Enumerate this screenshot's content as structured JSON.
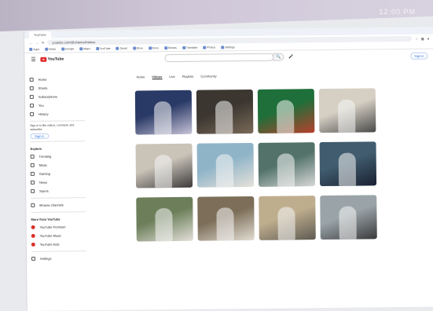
{
  "device": {
    "clock": "12:00 PM"
  },
  "browser": {
    "tab_label": "YouTube",
    "address": "youtube.com/@channel/videos",
    "bookmarks": [
      "Apps",
      "News",
      "Google",
      "Maps",
      "YouTube",
      "Gmail",
      "Drive",
      "Docs",
      "Sheets",
      "Translate",
      "Photos",
      "Settings"
    ]
  },
  "header": {
    "logo_text": "YouTube",
    "search_value": "",
    "signin_label": "Sign in"
  },
  "sidebar": {
    "items": [
      {
        "label": "Home",
        "icon": "home-icon"
      },
      {
        "label": "Shorts",
        "icon": "shorts-icon"
      },
      {
        "label": "Subscriptions",
        "icon": "subscriptions-icon"
      },
      {
        "label": "You",
        "icon": "you-icon"
      },
      {
        "label": "History",
        "icon": "history-icon"
      }
    ],
    "signin_prompt": "Sign in to like videos, comment, and subscribe.",
    "signin_label": "Sign in",
    "explore_title": "Explore",
    "explore": [
      {
        "label": "Trending",
        "icon": "trending-icon"
      },
      {
        "label": "Music",
        "icon": "music-icon"
      },
      {
        "label": "Gaming",
        "icon": "gaming-icon"
      },
      {
        "label": "News",
        "icon": "news-icon"
      },
      {
        "label": "Sports",
        "icon": "sports-icon"
      }
    ],
    "browse_channels": "Browse channels",
    "more_title": "More from YouTube",
    "more": [
      "YouTube Premium",
      "YouTube Music",
      "YouTube Kids"
    ],
    "settings_label": "Settings"
  },
  "chips": [
    "Home",
    "Videos",
    "Live",
    "Playlists",
    "Community"
  ],
  "videos": [
    {
      "title": "",
      "meta": "",
      "duration": "",
      "colors": [
        "#2a3a66",
        "#c7c3d8"
      ]
    },
    {
      "title": "",
      "meta": "",
      "duration": "",
      "colors": [
        "#3b3630",
        "#7a6a58"
      ]
    },
    {
      "title": "",
      "meta": "",
      "duration": "",
      "colors": [
        "#1f6f3a",
        "#b6402c"
      ]
    },
    {
      "title": "",
      "meta": "",
      "duration": "",
      "colors": [
        "#d6d0c4",
        "#4a4a4a"
      ]
    },
    {
      "title": "",
      "meta": "",
      "duration": "",
      "colors": [
        "#c9c3b8",
        "#3c3a3a"
      ]
    },
    {
      "title": "",
      "meta": "",
      "duration": "",
      "colors": [
        "#8fb4c8",
        "#e6e1da"
      ]
    },
    {
      "title": "",
      "meta": "",
      "duration": "",
      "colors": [
        "#53736a",
        "#d8d8d8"
      ]
    },
    {
      "title": "",
      "meta": "",
      "duration": "",
      "colors": [
        "#405c6e",
        "#1a2233"
      ]
    },
    {
      "title": "",
      "meta": "",
      "duration": "",
      "colors": [
        "#6c7f5a",
        "#e3e0d9"
      ]
    },
    {
      "title": "",
      "meta": "",
      "duration": "",
      "colors": [
        "#7c6e58",
        "#e2ddd3"
      ]
    },
    {
      "title": "",
      "meta": "",
      "duration": "",
      "colors": [
        "#bfae8e",
        "#5e5a52"
      ]
    },
    {
      "title": "",
      "meta": "",
      "duration": "",
      "colors": [
        "#9aa4a8",
        "#3a3a3c"
      ]
    }
  ]
}
